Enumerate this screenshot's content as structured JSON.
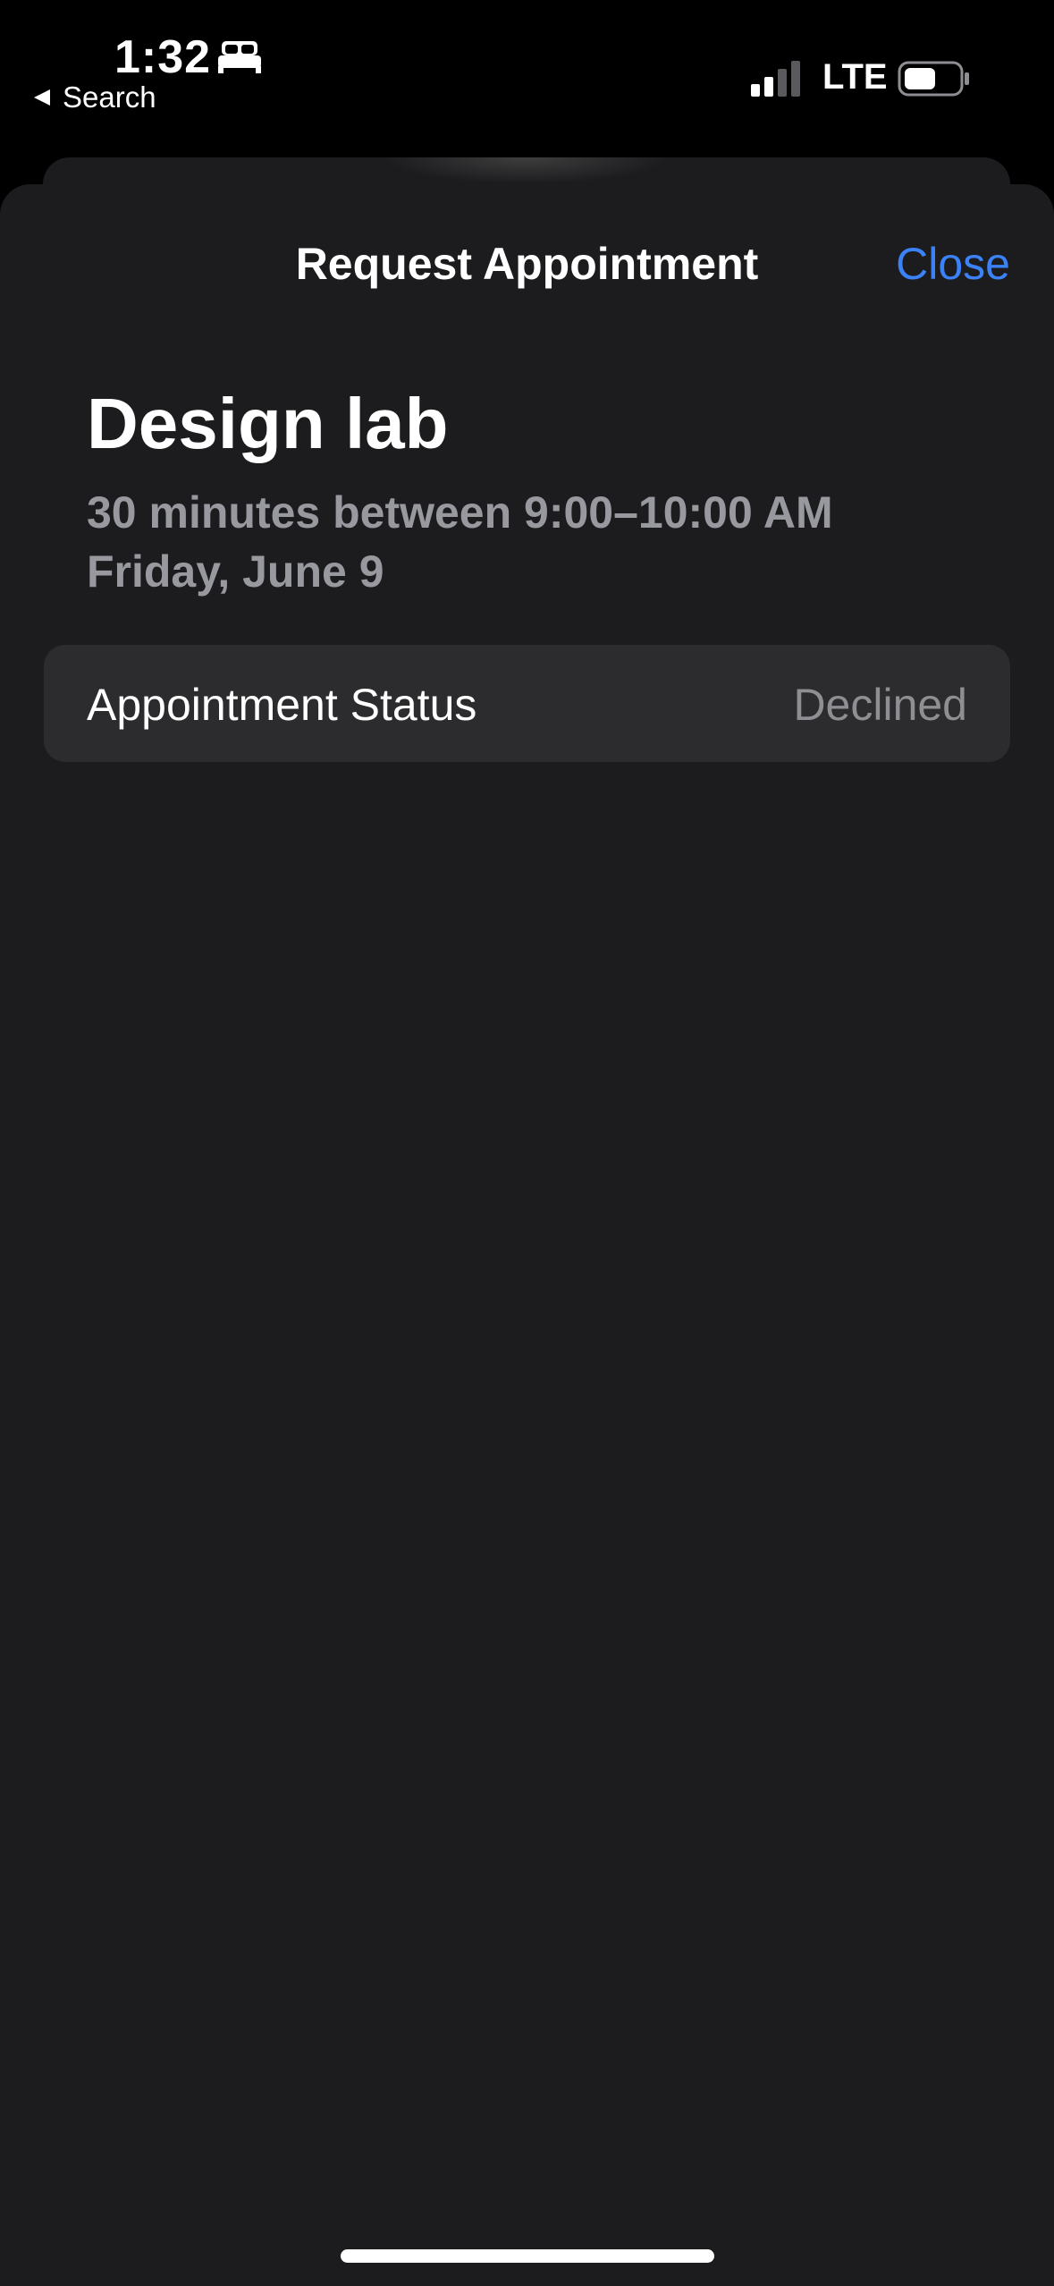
{
  "status_bar": {
    "time": "1:32",
    "back_label": "Search",
    "network": "LTE",
    "icons": [
      "sleep-bed-icon",
      "back-arrow-icon",
      "cellular-signal-icon",
      "battery-icon"
    ]
  },
  "navigation": {
    "title": "Request Appointment",
    "close_label": "Close"
  },
  "event": {
    "title": "Design lab",
    "duration": "30 minutes between 9:00–10:00 AM",
    "date": "Friday, June 9"
  },
  "status_row": {
    "label": "Appointment Status",
    "value": "Declined"
  },
  "colors": {
    "background": "#000000",
    "sheet": "#1c1c1e",
    "card": "#2c2c2e",
    "accent": "#3b82f6",
    "secondary_text": "#98989f"
  }
}
